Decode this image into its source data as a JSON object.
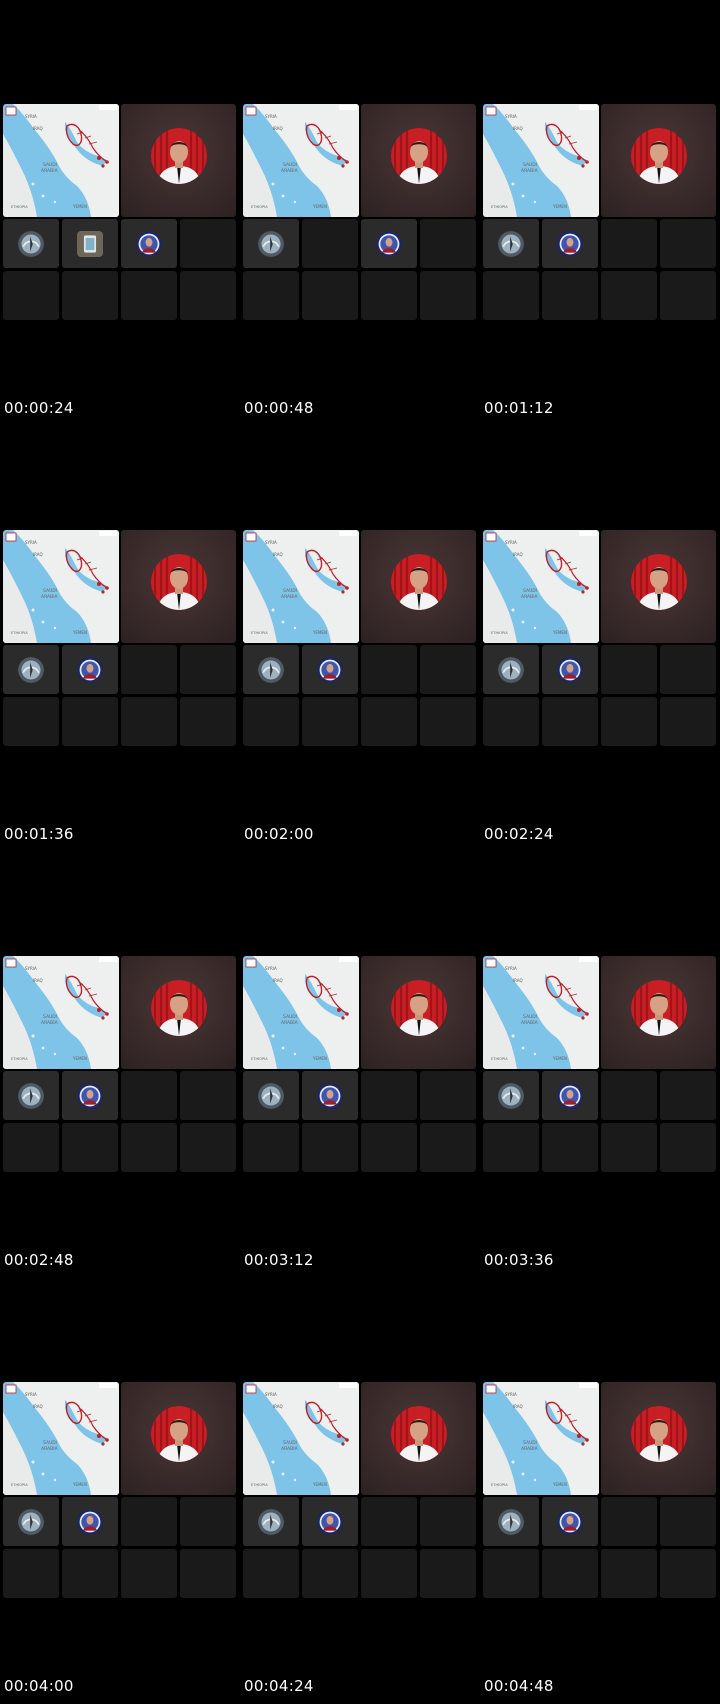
{
  "grid": {
    "frames": [
      {
        "timestamp": "00:00:24",
        "small_tiles": [
          {
            "icon": "compass-avatar-icon"
          },
          {
            "icon": "phone-avatar-icon"
          },
          {
            "icon": "speaker-avatar-icon"
          },
          {
            "icon": ""
          }
        ]
      },
      {
        "timestamp": "00:00:48",
        "small_tiles": [
          {
            "icon": "compass-avatar-icon"
          },
          {
            "icon": ""
          },
          {
            "icon": "speaker-avatar-icon"
          },
          {
            "icon": ""
          }
        ]
      },
      {
        "timestamp": "00:01:12",
        "small_tiles": [
          {
            "icon": "compass-avatar-icon"
          },
          {
            "icon": "speaker-avatar-icon"
          },
          {
            "icon": ""
          },
          {
            "icon": ""
          }
        ]
      },
      {
        "timestamp": "00:01:36",
        "small_tiles": [
          {
            "icon": "compass-avatar-icon"
          },
          {
            "icon": "speaker-avatar-icon"
          },
          {
            "icon": ""
          },
          {
            "icon": ""
          }
        ]
      },
      {
        "timestamp": "00:02:00",
        "small_tiles": [
          {
            "icon": "compass-avatar-icon"
          },
          {
            "icon": "speaker-avatar-icon"
          },
          {
            "icon": ""
          },
          {
            "icon": ""
          }
        ]
      },
      {
        "timestamp": "00:02:24",
        "small_tiles": [
          {
            "icon": "compass-avatar-icon"
          },
          {
            "icon": "speaker-avatar-icon"
          },
          {
            "icon": ""
          },
          {
            "icon": ""
          }
        ]
      },
      {
        "timestamp": "00:02:48",
        "small_tiles": [
          {
            "icon": "compass-avatar-icon"
          },
          {
            "icon": "speaker-avatar-icon"
          },
          {
            "icon": ""
          },
          {
            "icon": ""
          }
        ]
      },
      {
        "timestamp": "00:03:12",
        "small_tiles": [
          {
            "icon": "compass-avatar-icon"
          },
          {
            "icon": "speaker-avatar-icon"
          },
          {
            "icon": ""
          },
          {
            "icon": ""
          }
        ]
      },
      {
        "timestamp": "00:03:36",
        "small_tiles": [
          {
            "icon": "compass-avatar-icon"
          },
          {
            "icon": "speaker-avatar-icon"
          },
          {
            "icon": ""
          },
          {
            "icon": ""
          }
        ]
      },
      {
        "timestamp": "00:04:00",
        "small_tiles": [
          {
            "icon": "compass-avatar-icon"
          },
          {
            "icon": "speaker-avatar-icon"
          },
          {
            "icon": ""
          },
          {
            "icon": ""
          }
        ]
      },
      {
        "timestamp": "00:04:24",
        "small_tiles": [
          {
            "icon": "compass-avatar-icon"
          },
          {
            "icon": "speaker-avatar-icon"
          },
          {
            "icon": ""
          },
          {
            "icon": ""
          }
        ]
      },
      {
        "timestamp": "00:04:48",
        "small_tiles": [
          {
            "icon": "compass-avatar-icon"
          },
          {
            "icon": "speaker-avatar-icon"
          },
          {
            "icon": ""
          },
          {
            "icon": ""
          }
        ]
      }
    ],
    "colors": {
      "background": "#000000",
      "tile_empty": "#1a1a1a",
      "tile_active": "#2b2b2b",
      "sea": "#7ec3e8",
      "land": "#eef0ef",
      "route": "#c0202a",
      "presenter_bg": "#3a2b2b",
      "curtain": "#c81e24"
    }
  }
}
